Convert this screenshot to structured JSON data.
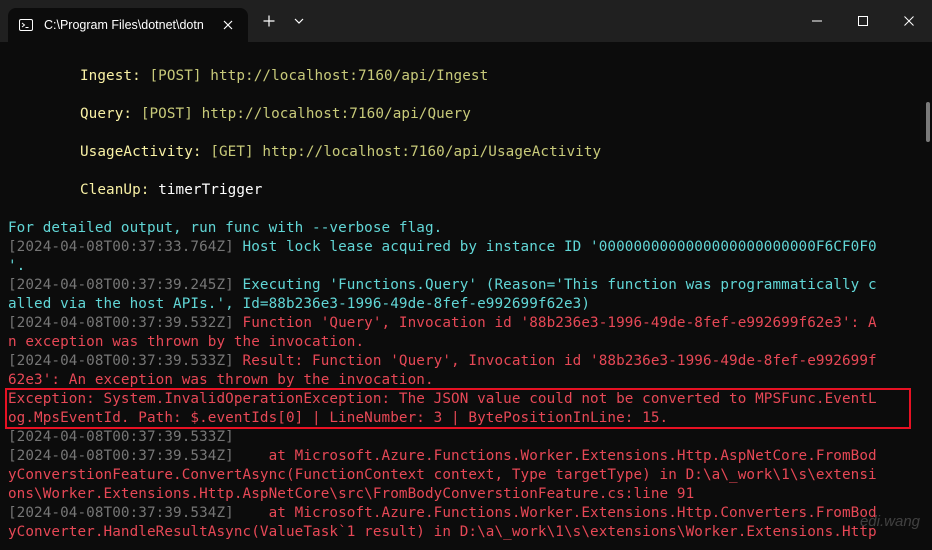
{
  "window": {
    "tab_title": "C:\\Program Files\\dotnet\\dotn"
  },
  "functions": [
    {
      "name": "Ingest:",
      "route": "[POST] http://localhost:7160/api/Ingest"
    },
    {
      "name": "Query:",
      "route": "[POST] http://localhost:7160/api/Query"
    },
    {
      "name": "UsageActivity:",
      "route": "[GET] http://localhost:7160/api/UsageActivity"
    },
    {
      "name": "CleanUp:",
      "route": "timerTrigger"
    }
  ],
  "log": {
    "verbose_hint": "For detailed output, run func with --verbose flag.",
    "l1_ts": "[2024-04-08T00:37:33.764Z]",
    "l1_msg": " Host lock lease acquired by instance ID '0000000000000000000000000F6CF0F0",
    "l1_cont": "'.",
    "l2_ts": "[2024-04-08T00:37:39.245Z]",
    "l2_msg": " Executing 'Functions.Query' (Reason='This function was programmatically c",
    "l2_cont": "alled via the host APIs.', Id=88b236e3-1996-49de-8fef-e992699f62e3)",
    "l3_ts": "[2024-04-08T00:37:39.532Z]",
    "l3_msg": " Function 'Query', Invocation id '88b236e3-1996-49de-8fef-e992699f62e3': A",
    "l3_cont": "n exception was thrown by the invocation.",
    "l4_ts": "[2024-04-08T00:37:39.533Z]",
    "l4_msg": " Result: Function 'Query', Invocation id '88b236e3-1996-49de-8fef-e992699f",
    "l4_cont": "62e3': An exception was thrown by the invocation.",
    "ex_line1": "Exception: System.InvalidOperationException: The JSON value could not be converted to MPSFunc.EventL",
    "ex_line2": "og.MpsEventId. Path: $.eventIds[0] | LineNumber: 3 | BytePositionInLine: 15.",
    "l5_ts": "[2024-04-08T00:37:39.533Z]",
    "l6_ts": "[2024-04-08T00:37:39.534Z]",
    "l6_msg": "    at Microsoft.Azure.Functions.Worker.Extensions.Http.AspNetCore.FromBod",
    "l6_cont1": "yConverstionFeature.ConvertAsync(FunctionContext context, Type targetType) in D:\\a\\_work\\1\\s\\extensi",
    "l6_cont2": "ons\\Worker.Extensions.Http.AspNetCore\\src\\FromBodyConverstionFeature.cs:line 91",
    "l7_ts": "[2024-04-08T00:37:39.534Z]",
    "l7_msg": "    at Microsoft.Azure.Functions.Worker.Extensions.Http.Converters.FromBod",
    "l7_cont": "yConverter.HandleResultAsync(ValueTask`1 result) in D:\\a\\_work\\1\\s\\extensions\\Worker.Extensions.Http"
  },
  "watermark": "edi.wang",
  "colors": {
    "background": "#0c0c0c",
    "titlebar": "#202020",
    "cyan": "#61d6d6",
    "gray": "#767676",
    "red": "#e74856",
    "yellow": "#f9f1a5",
    "highlight_border": "#e81123"
  }
}
